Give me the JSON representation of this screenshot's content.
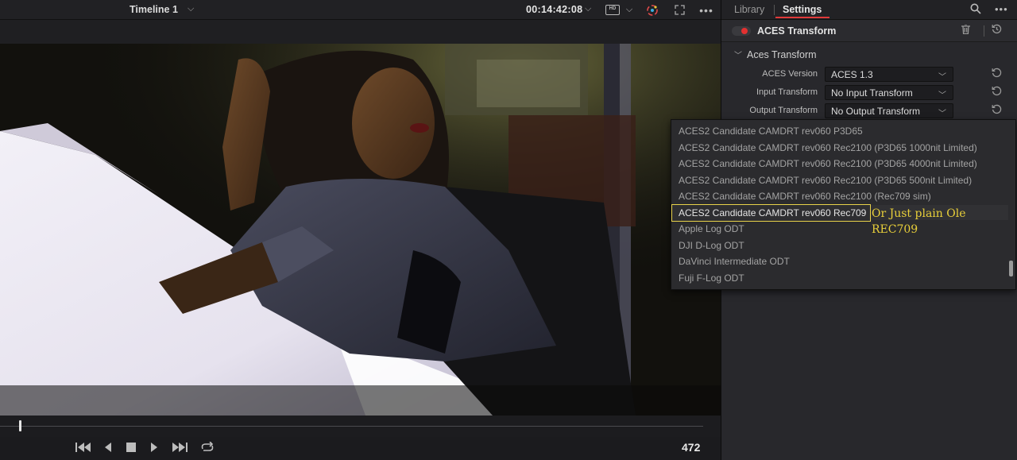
{
  "viewer": {
    "timeline_title": "Timeline 1",
    "timecode": "00:14:42:08",
    "hd_badge": "HD",
    "frame_number": "472",
    "icons": {
      "timeline_menu": "chevron-down-icon",
      "timecode_menu": "chevron-down-icon",
      "output": "hd-monitor-icon",
      "color": "color-wheel-icon",
      "expand": "expand-icon",
      "more": "more-icon"
    }
  },
  "transport": {
    "icons": [
      "skip-to-start-icon",
      "play-reverse-icon",
      "stop-icon",
      "play-icon",
      "skip-to-end-icon",
      "loop-icon"
    ]
  },
  "panel": {
    "tabs": [
      {
        "label": "Library",
        "active": false
      },
      {
        "label": "Settings",
        "active": true
      }
    ],
    "effect": {
      "title": "ACES Transform",
      "enabled": true,
      "toggle_color": "#e23030"
    },
    "section_title": "Aces Transform",
    "params": [
      {
        "label": "ACES Version",
        "value": "ACES 1.3"
      },
      {
        "label": "Input Transform",
        "value": "No Input Transform"
      },
      {
        "label": "Output Transform",
        "value": "No Output Transform"
      }
    ]
  },
  "dropdown": {
    "items": [
      "ACES2 Candidate CAMDRT rev060 P3D65",
      "ACES2 Candidate CAMDRT rev060 Rec2100 (P3D65 1000nit Limited)",
      "ACES2 Candidate CAMDRT rev060 Rec2100 (P3D65 4000nit Limited)",
      "ACES2 Candidate CAMDRT rev060 Rec2100 (P3D65 500nit Limited)",
      "ACES2 Candidate CAMDRT rev060 Rec2100 (Rec709 sim)",
      "ACES2 Candidate CAMDRT rev060 Rec709",
      "Apple Log ODT",
      "DJI D-Log ODT",
      "DaVinci Intermediate ODT",
      "Fuji F-Log ODT"
    ],
    "selected_index": 5,
    "annotation": "Or Just plain Ole REC709",
    "annotation_color": "#e8cf3a",
    "highlight_color": "#e8d24a"
  },
  "colors": {
    "accent": "#e03a3a",
    "panel_bg": "#28282c",
    "viewer_bg": "#1b1b1e"
  }
}
